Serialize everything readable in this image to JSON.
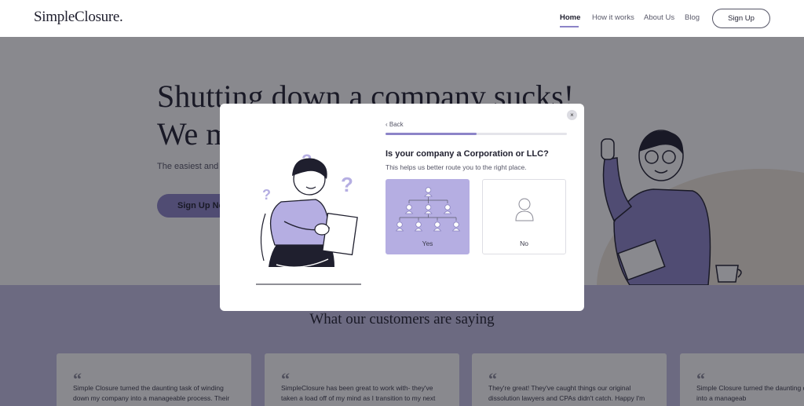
{
  "nav": {
    "logo": "SimpleClosure.",
    "links": [
      {
        "label": "Home",
        "active": true
      },
      {
        "label": "How it works"
      },
      {
        "label": "About Us"
      },
      {
        "label": "Blog"
      }
    ],
    "signup_label": "Sign Up"
  },
  "hero": {
    "title_line1": "Shutting down a company sucks!",
    "title_line2": "We m",
    "subtitle": "The easiest and m",
    "cta_label": "Sign Up No"
  },
  "testimonials": {
    "heading": "What our customers are saying",
    "quote_mark": "“",
    "cards": [
      {
        "text": "Simple Closure turned the daunting task of winding down my company into a manageable process. Their"
      },
      {
        "text": "SimpleClosure has been great to work with- they've taken a load off of my mind as I transition to my next"
      },
      {
        "text": "They're great! They've caught things our original dissolution lawyers and CPAs didn't catch. Happy I'm"
      },
      {
        "text": "Simple Closure turned the daunting down my company into a manageab"
      }
    ]
  },
  "modal": {
    "close_label": "×",
    "back_label": "‹ Back",
    "progress": 0.5,
    "question": "Is your company a Corporation or LLC?",
    "helper": "This helps us better route you to the right place.",
    "options": [
      {
        "label": "Yes",
        "selected": true,
        "icon": "org-chart-icon"
      },
      {
        "label": "No",
        "selected": false,
        "icon": "single-person-icon"
      }
    ]
  },
  "colors": {
    "accent": "#8c84c8",
    "selected_option": "#b5aee2",
    "testimonial_band": "#c5c1e4",
    "hero_blob": "#efe6da"
  }
}
